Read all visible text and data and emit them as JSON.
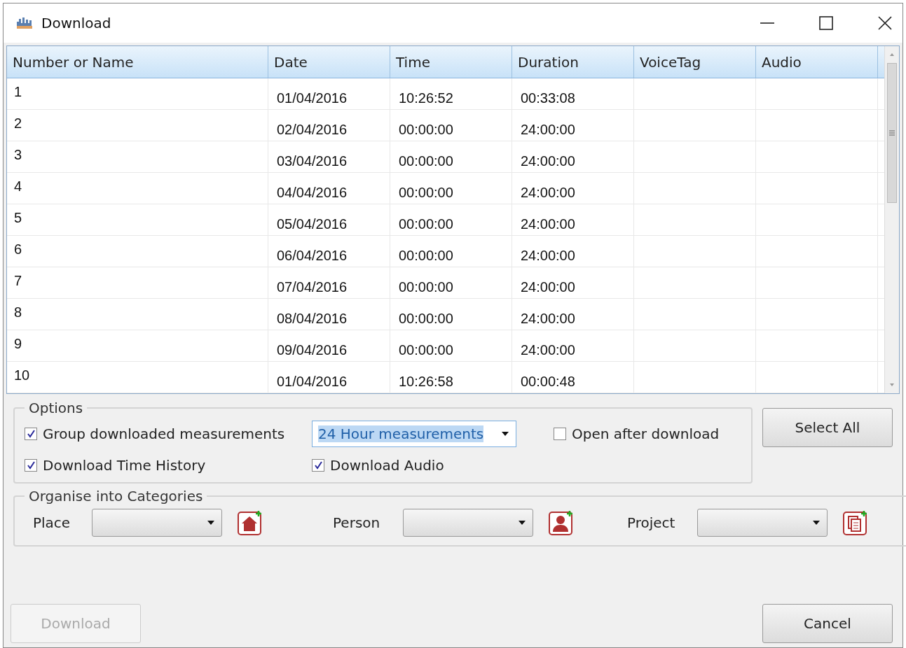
{
  "window": {
    "title": "Download"
  },
  "table": {
    "columns": [
      "Number or Name",
      "Date",
      "Time",
      "Duration",
      "VoiceTag",
      "Audio"
    ],
    "rows": [
      [
        "1",
        "01/04/2016",
        "10:26:52",
        "00:33:08",
        "",
        ""
      ],
      [
        "2",
        "02/04/2016",
        "00:00:00",
        "24:00:00",
        "",
        ""
      ],
      [
        "3",
        "03/04/2016",
        "00:00:00",
        "24:00:00",
        "",
        ""
      ],
      [
        "4",
        "04/04/2016",
        "00:00:00",
        "24:00:00",
        "",
        ""
      ],
      [
        "5",
        "05/04/2016",
        "00:00:00",
        "24:00:00",
        "",
        ""
      ],
      [
        "6",
        "06/04/2016",
        "00:00:00",
        "24:00:00",
        "",
        ""
      ],
      [
        "7",
        "07/04/2016",
        "00:00:00",
        "24:00:00",
        "",
        ""
      ],
      [
        "8",
        "08/04/2016",
        "00:00:00",
        "24:00:00",
        "",
        ""
      ],
      [
        "9",
        "09/04/2016",
        "00:00:00",
        "24:00:00",
        "",
        ""
      ],
      [
        "10",
        "01/04/2016",
        "10:26:58",
        "00:00:48",
        "",
        ""
      ]
    ]
  },
  "options": {
    "title": "Options",
    "items": [
      {
        "kind": "checkbox",
        "label": "Group downloaded measurements",
        "checked": true
      },
      {
        "kind": "dropdown",
        "value": "24 Hour measurements"
      },
      {
        "kind": "checkbox",
        "label": "Open after download",
        "checked": false
      },
      {
        "kind": "checkbox",
        "label": "Download Time History",
        "checked": true
      },
      {
        "kind": "checkbox",
        "label": "Download Audio",
        "checked": true
      }
    ]
  },
  "select_all": "Select All",
  "categories": {
    "title": "Organise into Categories",
    "items": [
      {
        "label": "Place",
        "kind": "place"
      },
      {
        "label": "Person",
        "kind": "person"
      },
      {
        "label": "Project",
        "kind": "project"
      }
    ]
  },
  "buttons": [
    {
      "label": "Download",
      "disabled": true
    },
    {
      "label": "Cancel",
      "disabled": false
    }
  ]
}
